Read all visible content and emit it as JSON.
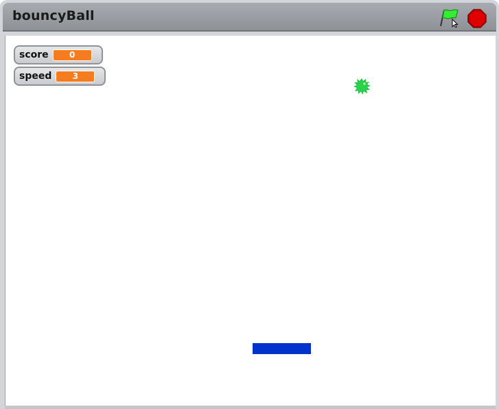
{
  "window": {
    "title": "bouncyBall"
  },
  "controls": {
    "green_flag_icon": "green-flag-icon",
    "stop_icon": "stop-sign-icon"
  },
  "monitors": {
    "score": {
      "label": "score",
      "value": "0"
    },
    "speed": {
      "label": "speed",
      "value": "3"
    }
  },
  "colors": {
    "monitor_value_bg": "#f57d1f",
    "paddle": "#0033cc",
    "ball": "#22c244",
    "flag": "#33ee33",
    "stop": "#cc0000"
  }
}
